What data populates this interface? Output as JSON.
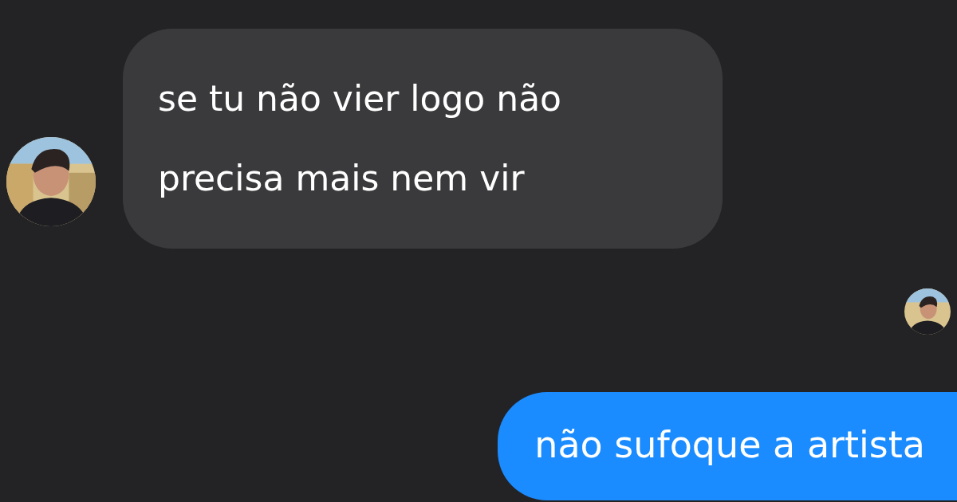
{
  "messages": [
    {
      "kind": "incoming",
      "text": "se tu não vier logo não precisa mais nem vir"
    },
    {
      "kind": "read_receipt"
    },
    {
      "kind": "outgoing",
      "text": "não sufoque a artista"
    }
  ]
}
